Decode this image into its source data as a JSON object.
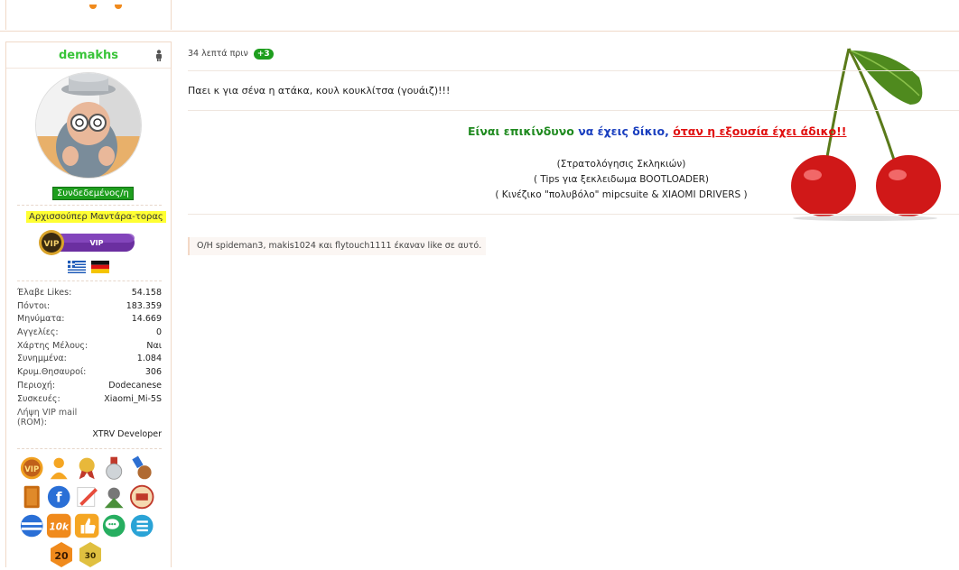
{
  "user": {
    "username": "demakhs",
    "status": "Συνδεδεμένος/η",
    "rank": "Αρχισσούπερ Μαντάρα-τορας",
    "vip_label": "VIP",
    "vip_badge_text": "VIP",
    "stats": [
      {
        "label": "Έλαβε Likes:",
        "value": "54.158"
      },
      {
        "label": "Πόντοι:",
        "value": "183.359"
      },
      {
        "label": "Μηνύματα:",
        "value": "14.669"
      },
      {
        "label": "Αγγελίες:",
        "value": "0"
      },
      {
        "label": "Χάρτης Μέλους:",
        "value": "Ναι"
      },
      {
        "label": "Συνημμένα:",
        "value": "1.084"
      },
      {
        "label": "Κρυμ.Θησαυροί:",
        "value": "306"
      },
      {
        "label": "Περιοχή:",
        "value": "Dodecanese"
      },
      {
        "label": "Συσκευές:",
        "value": "Xiaomi_Mi-5S"
      }
    ],
    "vip_mail_label": "Λήψη VIP mail (ROM):",
    "vip_mail_value": "XTRV Developer",
    "award_labels": {
      "a10k": "10k",
      "a20": "20",
      "a30": "30"
    }
  },
  "post": {
    "time": "34 λεπτά πριν",
    "like_count": "+3",
    "message": "Παει κ για σένα η ατάκα, κουλ κουκλίτσα (γουάιζ)!!!",
    "signature": {
      "quote_part1": "Είναι επικίνδυνο",
      "quote_part2": " να έχεις δίκιο,",
      "quote_part3": "όταν η εξουσία έχει άδικο!!",
      "lines": [
        "(Στρατολόγησις Σκληκιών)",
        "( Tips για ξεκλειδωμα BOOTLOADER)",
        "( Κινέζικο \"πολυβόλο\" mipcsuite & XIAOMI DRIVERS )"
      ]
    },
    "likes_text": "O/H spideman3, makis1024 και flytouch1111 έκαναν like σε αυτό."
  },
  "colors": {
    "username": "#39c439",
    "online_bg": "#1e9e1e",
    "rank_bg": "#ffff33",
    "quote_green": "#1f8a1f",
    "quote_blue": "#1a3fbf",
    "quote_red": "#e01010"
  }
}
